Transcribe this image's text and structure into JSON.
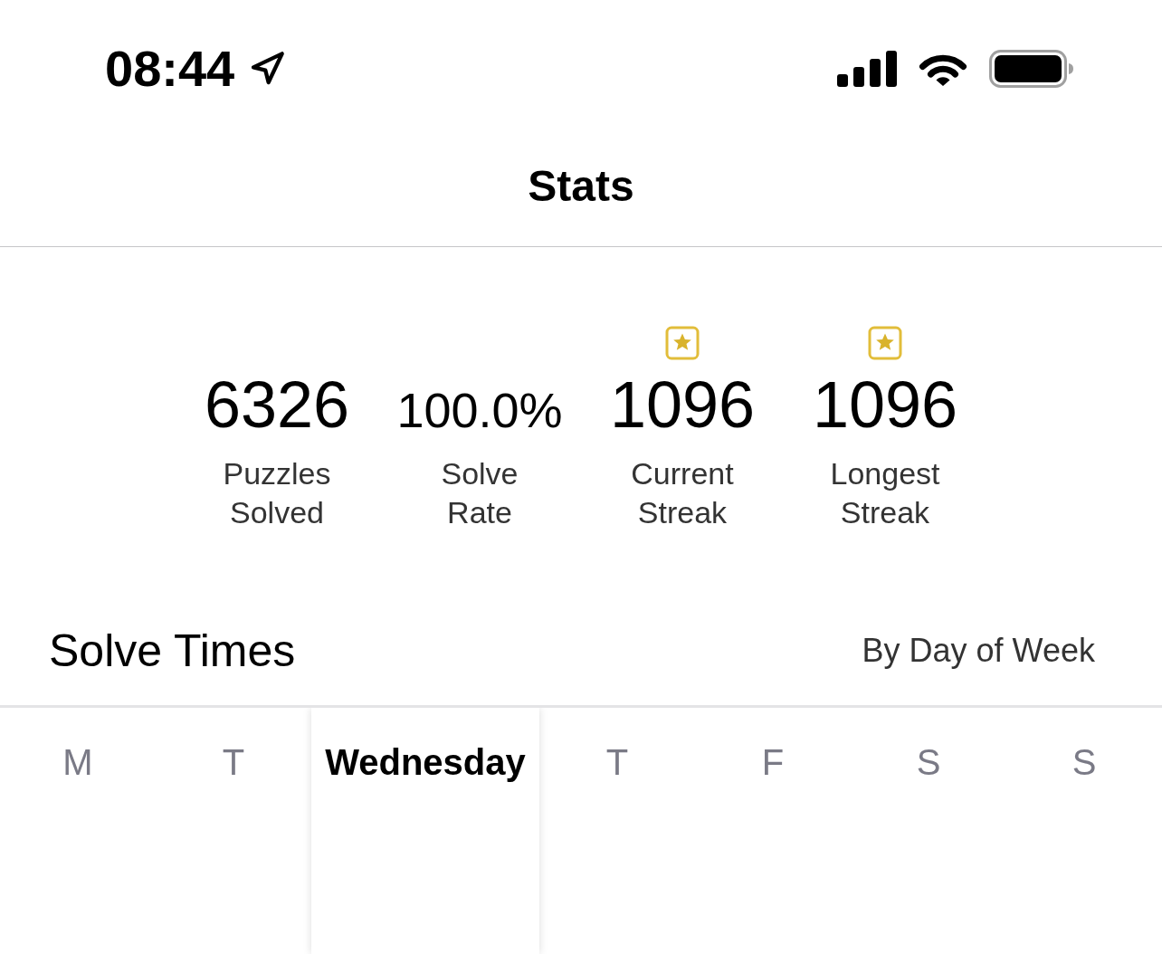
{
  "status_bar": {
    "time": "08:44"
  },
  "header": {
    "title": "Stats"
  },
  "stats": [
    {
      "value": "6326",
      "label": "Puzzles Solved",
      "kind": "count",
      "starred": false
    },
    {
      "value": "100.0%",
      "label": "Solve Rate",
      "kind": "percent",
      "starred": false
    },
    {
      "value": "1096",
      "label": "Current Streak",
      "kind": "count",
      "starred": true
    },
    {
      "value": "1096",
      "label": "Longest Streak",
      "kind": "count",
      "starred": true
    }
  ],
  "solve_times": {
    "title": "Solve Times",
    "view": "By Day of Week",
    "days": [
      {
        "label": "M",
        "selected": false
      },
      {
        "label": "T",
        "selected": false
      },
      {
        "label": "Wednesday",
        "selected": true
      },
      {
        "label": "T",
        "selected": false
      },
      {
        "label": "F",
        "selected": false
      },
      {
        "label": "S",
        "selected": false
      },
      {
        "label": "S",
        "selected": false
      }
    ]
  }
}
